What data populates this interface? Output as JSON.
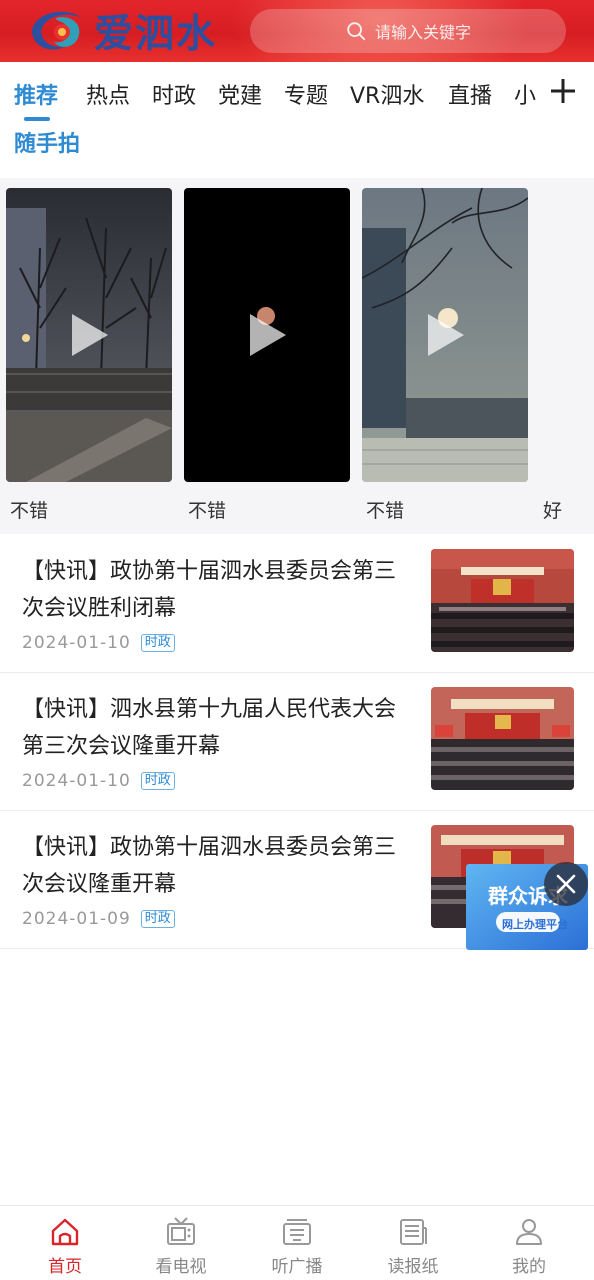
{
  "header": {
    "app_name": "爱泗水",
    "search_placeholder": "请输入关键字",
    "brand_color": "#d61d22",
    "logo_color": "#2c4fa0"
  },
  "tabs": {
    "items": [
      {
        "label": "推荐",
        "active": true
      },
      {
        "label": "热点"
      },
      {
        "label": "时政"
      },
      {
        "label": "党建"
      },
      {
        "label": "专题"
      },
      {
        "label": "VR泗水"
      },
      {
        "label": "直播"
      },
      {
        "label": "小"
      }
    ],
    "second_row": "随手拍",
    "accent_color": "#2e8bd3",
    "add_icon": "plus-icon"
  },
  "videos": [
    {
      "caption": "不错",
      "scene": "night-trees-street"
    },
    {
      "caption": "不错",
      "scene": "black-moon"
    },
    {
      "caption": "不错",
      "scene": "moon-branches-building"
    },
    {
      "caption": "好"
    }
  ],
  "news": [
    {
      "title": "【快讯】政协第十届泗水县委员会第三次会议胜利闭幕",
      "date": "2024-01-10",
      "tag": "时政"
    },
    {
      "title": "【快讯】泗水县第十九届人民代表大会第三次会议隆重开幕",
      "date": "2024-01-10",
      "tag": "时政"
    },
    {
      "title": "【快讯】政协第十届泗水县委员会第三次会议隆重开幕",
      "date": "2024-01-09",
      "tag": "时政"
    }
  ],
  "float_ad": {
    "title": "群众诉求",
    "subtitle": "网上办理平台"
  },
  "bottom_nav": [
    {
      "label": "首页",
      "icon": "home-icon",
      "active": true
    },
    {
      "label": "看电视",
      "icon": "tv-icon"
    },
    {
      "label": "听广播",
      "icon": "radio-icon"
    },
    {
      "label": "读报纸",
      "icon": "newspaper-icon"
    },
    {
      "label": "我的",
      "icon": "user-icon"
    }
  ],
  "active_color": "#d8262d"
}
